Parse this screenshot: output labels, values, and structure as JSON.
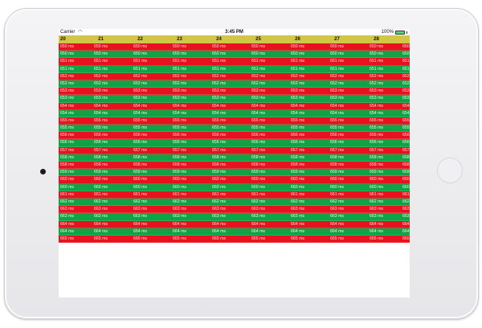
{
  "statusbar": {
    "carrier": "Carrier",
    "time": "3:45 PM",
    "battery": "100%"
  },
  "header": {
    "columns": [
      "20",
      "21",
      "22",
      "23",
      "24",
      "25",
      "26",
      "27",
      "28",
      "29"
    ]
  },
  "rows": [
    {
      "label": "650 ms",
      "color": "red"
    },
    {
      "label": "650 ms",
      "color": "green"
    },
    {
      "label": "651 ms",
      "color": "red"
    },
    {
      "label": "651 ms",
      "color": "green"
    },
    {
      "label": "652 ms",
      "color": "red"
    },
    {
      "label": "652 ms",
      "color": "green"
    },
    {
      "label": "653 ms",
      "color": "red"
    },
    {
      "label": "653 ms",
      "color": "green"
    },
    {
      "label": "654 ms",
      "color": "red"
    },
    {
      "label": "654 ms",
      "color": "green"
    },
    {
      "label": "655 ms",
      "color": "red"
    },
    {
      "label": "655 ms",
      "color": "green"
    },
    {
      "label": "656 ms",
      "color": "red"
    },
    {
      "label": "656 ms",
      "color": "green"
    },
    {
      "label": "657 ms",
      "color": "red"
    },
    {
      "label": "658 ms",
      "color": "green"
    },
    {
      "label": "658 ms",
      "color": "red"
    },
    {
      "label": "659 ms",
      "color": "green"
    },
    {
      "label": "660 ms",
      "color": "red"
    },
    {
      "label": "660 ms",
      "color": "green"
    },
    {
      "label": "661 ms",
      "color": "red"
    },
    {
      "label": "662 ms",
      "color": "green"
    },
    {
      "label": "663 ms",
      "color": "red"
    },
    {
      "label": "663 ms",
      "color": "green"
    },
    {
      "label": "664 ms",
      "color": "red"
    },
    {
      "label": "664 ms",
      "color": "green"
    },
    {
      "label": "665 ms",
      "color": "red"
    }
  ],
  "colors": {
    "red": "#e8121f",
    "green": "#10a245",
    "header": "#d2c64a"
  }
}
